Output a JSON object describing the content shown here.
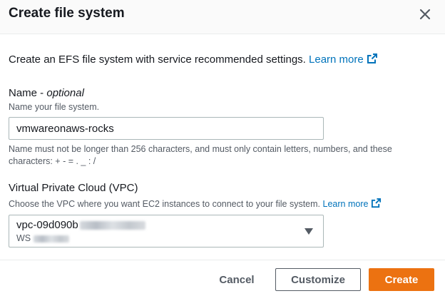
{
  "dialog": {
    "title": "Create file system",
    "close_icon": "close-icon"
  },
  "intro": {
    "text": "Create an EFS file system with service recommended settings.",
    "learn_more": "Learn more",
    "icon": "external-link-icon"
  },
  "name_field": {
    "label": "Name",
    "optional": "optional",
    "label_separator": " - ",
    "description": "Name your file system.",
    "value": "vmwareonaws-rocks",
    "constraint": "Name must not be longer than 256 characters, and must only contain letters, numbers, and these characters: + - = . _ : /"
  },
  "vpc_field": {
    "label": "Virtual Private Cloud (VPC)",
    "description": "Choose the VPC where you want EC2 instances to connect to your file system.",
    "learn_more": "Learn more",
    "icon": "external-link-icon",
    "selected_id_prefix": "vpc-09d090b",
    "selected_name_prefix": "WS",
    "caret_icon": "caret-down-icon"
  },
  "footer": {
    "cancel_label": "Cancel",
    "customize_label": "Customize",
    "create_label": "Create"
  },
  "colors": {
    "primary": "#ec7211",
    "link": "#0073bb",
    "text": "#16191f",
    "secondary_text": "#545b64"
  }
}
